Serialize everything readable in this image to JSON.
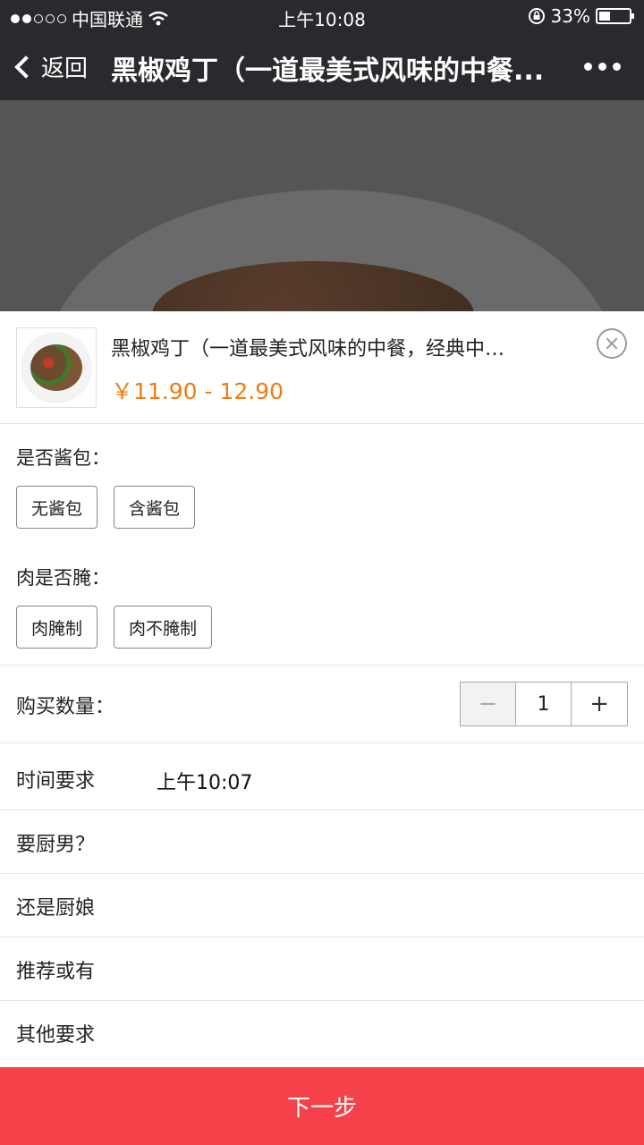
{
  "status_bar": {
    "carrier": "中国联通",
    "time": "上午10:08",
    "battery": "33%",
    "battery_level": 0.33
  },
  "nav": {
    "back_label": "返回",
    "title": "黑椒鸡丁（一道最美式风味的中餐..."
  },
  "product": {
    "name": "黑椒鸡丁（一道最美式风味的中餐，经典中…",
    "price": "￥11.90 - 12.90"
  },
  "options": [
    {
      "label": "是否酱包：",
      "choices": [
        "无酱包",
        "含酱包"
      ]
    },
    {
      "label": "肉是否腌：",
      "choices": [
        "肉腌制",
        "肉不腌制"
      ]
    }
  ],
  "quantity": {
    "label": "购买数量：",
    "minus": "−",
    "value": "1",
    "plus": "+"
  },
  "form": [
    {
      "label": "时间要求",
      "value": "上午10:07"
    },
    {
      "label": "要厨男？",
      "value": ""
    },
    {
      "label": "还是厨娘",
      "value": ""
    },
    {
      "label": "推荐或有",
      "value": ""
    },
    {
      "label": "其他要求",
      "value": ""
    }
  ],
  "next_label": "下一步"
}
